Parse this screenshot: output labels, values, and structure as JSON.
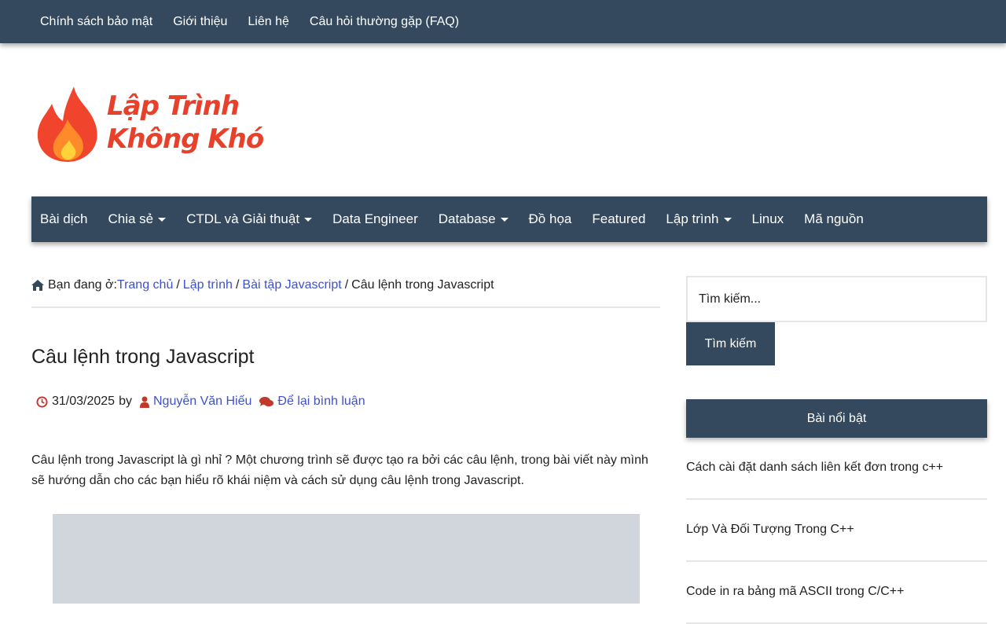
{
  "topbar": {
    "links": [
      "Chính sách bảo mật",
      "Giới thiệu",
      "Liên hệ",
      "Câu hỏi thường gặp (FAQ)"
    ]
  },
  "logo": {
    "line1": "Lập Trình",
    "line2": "Không Khó"
  },
  "mainnav": {
    "items": [
      {
        "label": "Bài dịch",
        "dropdown": false
      },
      {
        "label": "Chia sẻ",
        "dropdown": true
      },
      {
        "label": "CTDL và Giải thuật",
        "dropdown": true
      },
      {
        "label": "Data Engineer",
        "dropdown": false
      },
      {
        "label": "Database",
        "dropdown": true
      },
      {
        "label": "Đồ họa",
        "dropdown": false
      },
      {
        "label": "Featured",
        "dropdown": false
      },
      {
        "label": "Lập trình",
        "dropdown": true
      },
      {
        "label": "Linux",
        "dropdown": false
      },
      {
        "label": "Mã nguồn",
        "dropdown": false
      }
    ]
  },
  "breadcrumb": {
    "prefix": "Bạn đang ở:",
    "home": "Trang chủ",
    "sep": "/",
    "crumb1": "Lập trình",
    "crumb2": "Bài tập Javascript",
    "current": "Câu lệnh trong Javascript"
  },
  "post": {
    "title": "Câu lệnh trong Javascript",
    "date": "31/03/2025",
    "by": "by",
    "author": "Nguyễn Văn Hiếu",
    "comments": "Để lại bình luận",
    "intro": "Câu lệnh trong Javascript là gì nhỉ ? Một chương trình sẽ được tạo ra bởi các câu lệnh, trong bài viết này mình sẽ hướng dẫn cho các bạn hiểu rõ  khái niệm và cách sử dụng câu lệnh trong Javascript."
  },
  "sidebar": {
    "search_placeholder": "Tìm kiếm...",
    "search_button": "Tìm kiếm",
    "widget_title": "Bài nổi bật",
    "featured": [
      "Cách cài đặt danh sách liên kết đơn trong c++",
      "Lớp Và Đối Tượng Trong C++",
      "Code in ra bảng mã ASCII trong C/C++"
    ]
  },
  "colors": {
    "nav_bg": "#34495e",
    "link": "#3f51c8",
    "icon_red": "#c0392b",
    "logo_red": "#e8412b"
  }
}
